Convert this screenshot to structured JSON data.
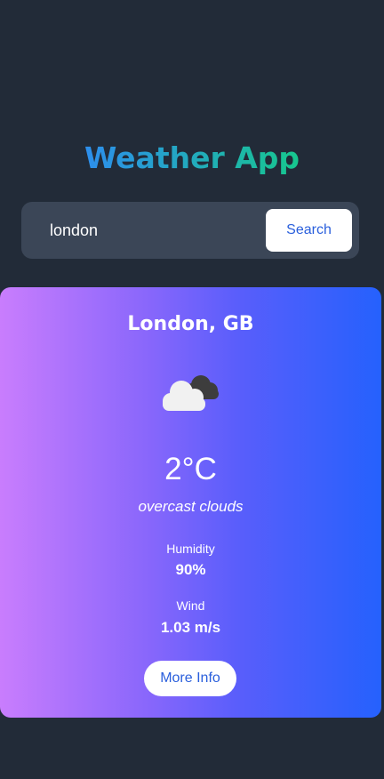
{
  "header": {
    "title": "Weather App"
  },
  "search": {
    "value": "london",
    "button_label": "Search"
  },
  "weather": {
    "city": "London, GB",
    "icon": "overcast-clouds-icon",
    "temperature": "2°C",
    "description": "overcast clouds",
    "humidity_label": "Humidity",
    "humidity_value": "90%",
    "wind_label": "Wind",
    "wind_value": "1.03 m/s",
    "more_info_label": "More Info"
  },
  "colors": {
    "background": "#222b38",
    "search_bar": "#3b4657",
    "title_gradient_start": "#2e8cf0",
    "title_gradient_end": "#16c98a",
    "card_gradient_start": "#c97dfd",
    "card_gradient_end": "#2561fd",
    "button_text": "#2a5fdc"
  }
}
